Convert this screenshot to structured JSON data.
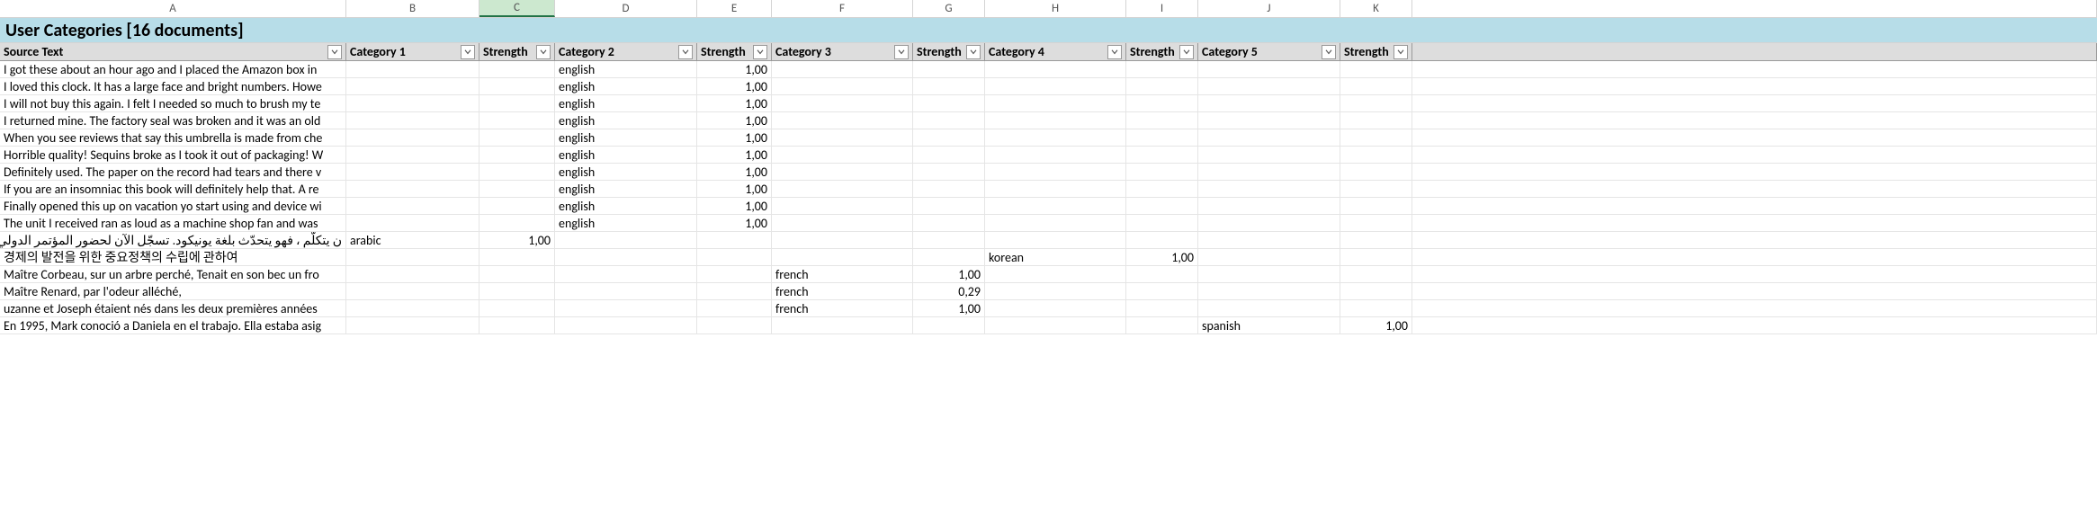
{
  "columns": [
    "A",
    "B",
    "C",
    "D",
    "E",
    "F",
    "G",
    "H",
    "I",
    "J",
    "K"
  ],
  "selected_column": "C",
  "title": "User Categories [16 documents]",
  "headers": {
    "source_text": "Source Text",
    "cat1": "Category 1",
    "str1": "Strength",
    "cat2": "Category 2",
    "str2": "Strength",
    "cat3": "Category 3",
    "str3": "Strength",
    "cat4": "Category 4",
    "str4": "Strength",
    "cat5": "Category 5",
    "str5": "Strength"
  },
  "rows": [
    {
      "src": "I got these about an hour ago and I placed the Amazon box in",
      "cat1": "",
      "str1": "",
      "cat2": "english",
      "str2": "1,00",
      "cat3": "",
      "str3": "",
      "cat4": "",
      "str4": "",
      "cat5": "",
      "str5": ""
    },
    {
      "src": "I loved this clock. It has a large face and bright numbers. Howe",
      "cat1": "",
      "str1": "",
      "cat2": "english",
      "str2": "1,00",
      "cat3": "",
      "str3": "",
      "cat4": "",
      "str4": "",
      "cat5": "",
      "str5": ""
    },
    {
      "src": "I will not buy this again. I felt I needed so much to brush my te",
      "cat1": "",
      "str1": "",
      "cat2": "english",
      "str2": "1,00",
      "cat3": "",
      "str3": "",
      "cat4": "",
      "str4": "",
      "cat5": "",
      "str5": ""
    },
    {
      "src": "I returned mine. The factory seal was broken and it was an old",
      "cat1": "",
      "str1": "",
      "cat2": "english",
      "str2": "1,00",
      "cat3": "",
      "str3": "",
      "cat4": "",
      "str4": "",
      "cat5": "",
      "str5": ""
    },
    {
      "src": "When you see reviews that say this umbrella is made from che",
      "cat1": "",
      "str1": "",
      "cat2": "english",
      "str2": "1,00",
      "cat3": "",
      "str3": "",
      "cat4": "",
      "str4": "",
      "cat5": "",
      "str5": ""
    },
    {
      "src": "Horrible quality! Sequins broke as I took it out of packaging! W",
      "cat1": "",
      "str1": "",
      "cat2": "english",
      "str2": "1,00",
      "cat3": "",
      "str3": "",
      "cat4": "",
      "str4": "",
      "cat5": "",
      "str5": ""
    },
    {
      "src": "Definitely used. The paper on the record had tears and there v",
      "cat1": "",
      "str1": "",
      "cat2": "english",
      "str2": "1,00",
      "cat3": "",
      "str3": "",
      "cat4": "",
      "str4": "",
      "cat5": "",
      "str5": ""
    },
    {
      "src": "If you are an insomniac this book will definitely help that. A re",
      "cat1": "",
      "str1": "",
      "cat2": "english",
      "str2": "1,00",
      "cat3": "",
      "str3": "",
      "cat4": "",
      "str4": "",
      "cat5": "",
      "str5": ""
    },
    {
      "src": "Finally opened this up on vacation yo start using and device wi",
      "cat1": "",
      "str1": "",
      "cat2": "english",
      "str2": "1,00",
      "cat3": "",
      "str3": "",
      "cat4": "",
      "str4": "",
      "cat5": "",
      "str5": ""
    },
    {
      "src": "The unit I received ran as loud as a machine shop fan and was",
      "cat1": "",
      "str1": "",
      "cat2": "english",
      "str2": "1,00",
      "cat3": "",
      "str3": "",
      "cat4": "",
      "str4": "",
      "cat5": "",
      "str5": ""
    },
    {
      "src": "ن  يتكلّم ، فهو يتحدّث بلغة يونيكود. تسجّل الآن لحضور المؤتمر الدولي العاشر ل",
      "rtl": true,
      "cat1": "arabic",
      "str1": "1,00",
      "cat2": "",
      "str2": "",
      "cat3": "",
      "str3": "",
      "cat4": "",
      "str4": "",
      "cat5": "",
      "str5": ""
    },
    {
      "src": "경제의 발전을 위한 중요정책의 수립에 관하여",
      "cat1": "",
      "str1": "",
      "cat2": "",
      "str2": "",
      "cat3": "",
      "str3": "",
      "cat4": "korean",
      "str4": "1,00",
      "cat5": "",
      "str5": ""
    },
    {
      "src": "Maître Corbeau, sur un arbre perché, Tenait en son bec un fro",
      "cat1": "",
      "str1": "",
      "cat2": "",
      "str2": "",
      "cat3": "french",
      "str3": "1,00",
      "cat4": "",
      "str4": "",
      "cat5": "",
      "str5": ""
    },
    {
      "src": "Maître Renard, par l'odeur alléché,",
      "cat1": "",
      "str1": "",
      "cat2": "",
      "str2": "",
      "cat3": "french",
      "str3": "0,29",
      "cat4": "",
      "str4": "",
      "cat5": "",
      "str5": ""
    },
    {
      "src": "uzanne et Joseph étaient nés dans les deux premières années",
      "cat1": "",
      "str1": "",
      "cat2": "",
      "str2": "",
      "cat3": "french",
      "str3": "1,00",
      "cat4": "",
      "str4": "",
      "cat5": "",
      "str5": ""
    },
    {
      "src": "En 1995, Mark conoció a Daniela en el trabajo. Ella estaba asig",
      "cat1": "",
      "str1": "",
      "cat2": "",
      "str2": "",
      "cat3": "",
      "str3": "",
      "cat4": "",
      "str4": "",
      "cat5": "spanish",
      "str5": "1,00"
    }
  ]
}
